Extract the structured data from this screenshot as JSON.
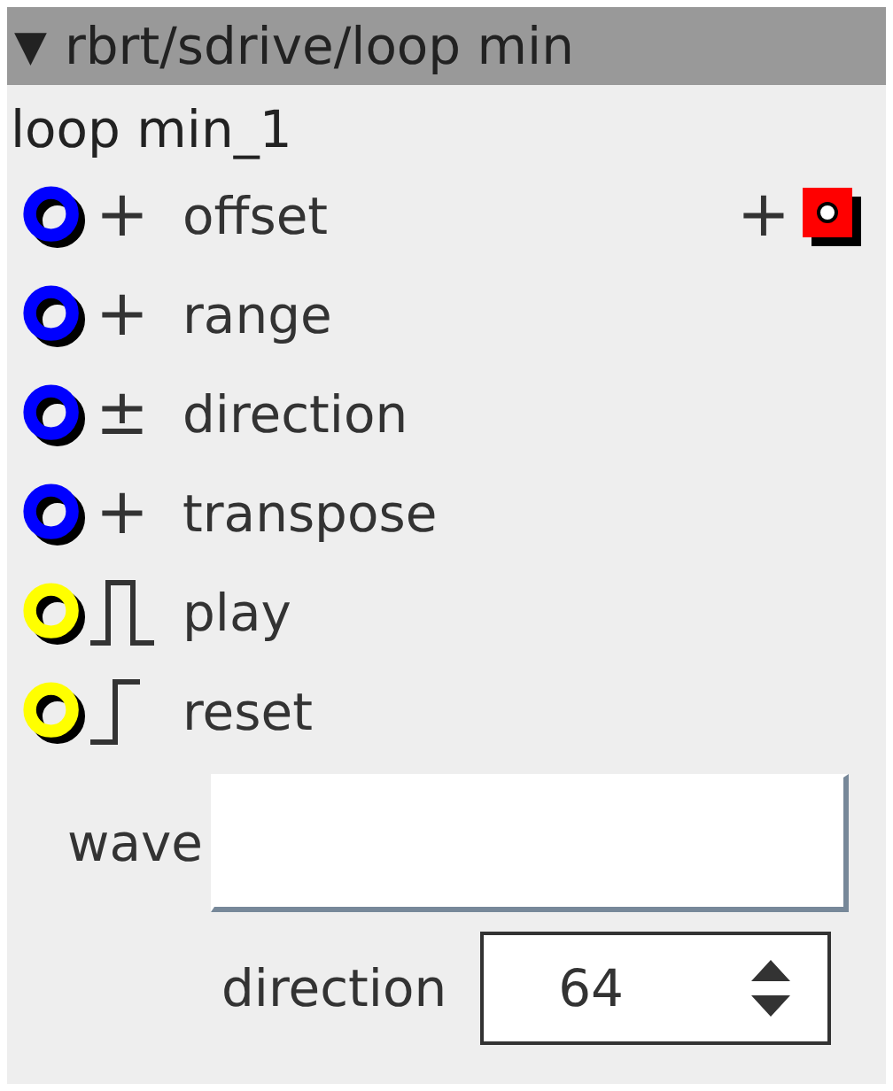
{
  "header": {
    "toggle": "▼",
    "title": "rbrt/sdrive/loop min"
  },
  "instance": "loop min_1",
  "inputs": [
    {
      "name": "offset",
      "color": "#0000ff",
      "kind": "text",
      "symbol": "+",
      "extra": "+"
    },
    {
      "name": "range",
      "color": "#0000ff",
      "kind": "text",
      "symbol": "+"
    },
    {
      "name": "direction",
      "color": "#0000ff",
      "kind": "text",
      "symbol": "±"
    },
    {
      "name": "transpose",
      "color": "#0000ff",
      "kind": "text",
      "symbol": "+"
    },
    {
      "name": "play",
      "color": "#ffff00",
      "kind": "pulse"
    },
    {
      "name": "reset",
      "color": "#ffff00",
      "kind": "step"
    }
  ],
  "wave": {
    "label": "wave"
  },
  "direction": {
    "label": "direction",
    "value": "64"
  }
}
